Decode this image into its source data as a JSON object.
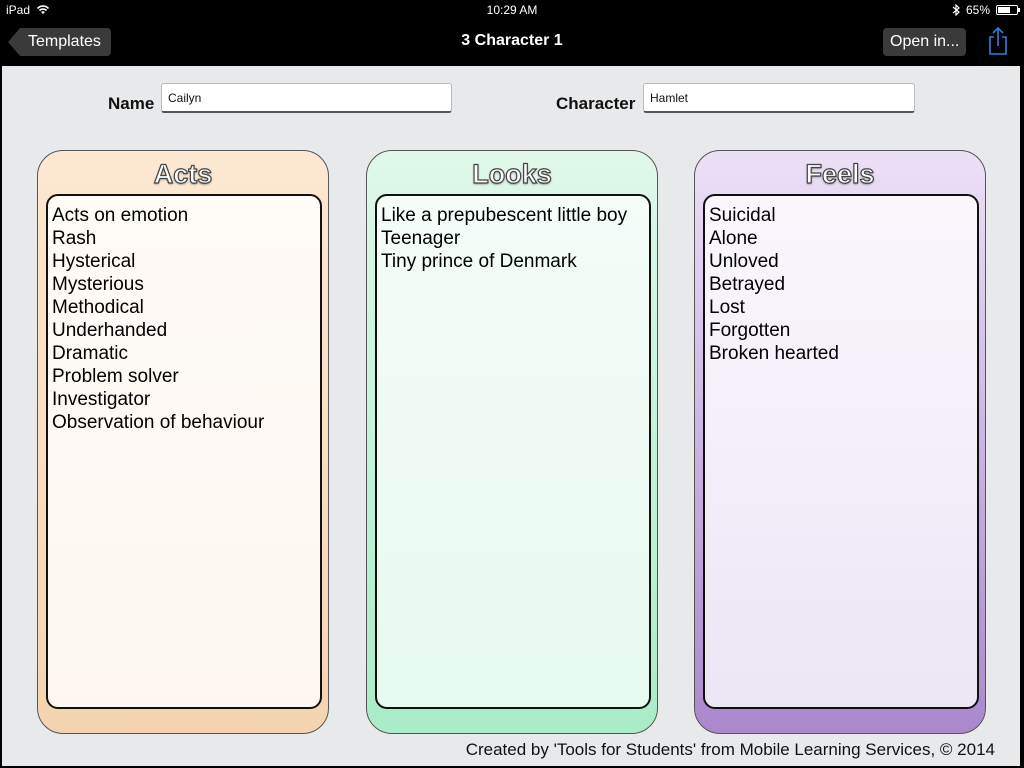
{
  "status_bar": {
    "device": "iPad",
    "time": "10:29 AM",
    "battery": "65%",
    "battery_level": 0.65,
    "icons": [
      "wifi-icon",
      "bluetooth-icon",
      "battery-icon"
    ]
  },
  "nav": {
    "back_label": "Templates",
    "title": "3 Character 1",
    "open_in_label": "Open in...",
    "share_icon": "share-icon",
    "accent_color": "#2f7de1"
  },
  "form": {
    "name_label": "Name",
    "name_value": "Cailyn",
    "character_label": "Character",
    "character_value": "Hamlet"
  },
  "columns": [
    {
      "title": "Acts",
      "color": "#f5d3b0",
      "items": [
        "Acts on emotion",
        "Rash",
        "Hysterical",
        "Mysterious",
        "Methodical",
        "Underhanded",
        "Dramatic",
        "Problem solver",
        "Investigator",
        "Observation of behaviour"
      ]
    },
    {
      "title": "Looks",
      "color": "#a9ecc8",
      "items": [
        "Like a prepubescent little boy",
        "Teenager",
        "Tiny prince of Denmark"
      ]
    },
    {
      "title": "Feels",
      "color": "#a988cc",
      "items": [
        "Suicidal",
        "Alone",
        "Unloved",
        "Betrayed",
        "Lost",
        "Forgotten",
        "Broken hearted"
      ]
    }
  ],
  "footer": "Created by 'Tools for Students' from Mobile Learning Services, © 2014"
}
